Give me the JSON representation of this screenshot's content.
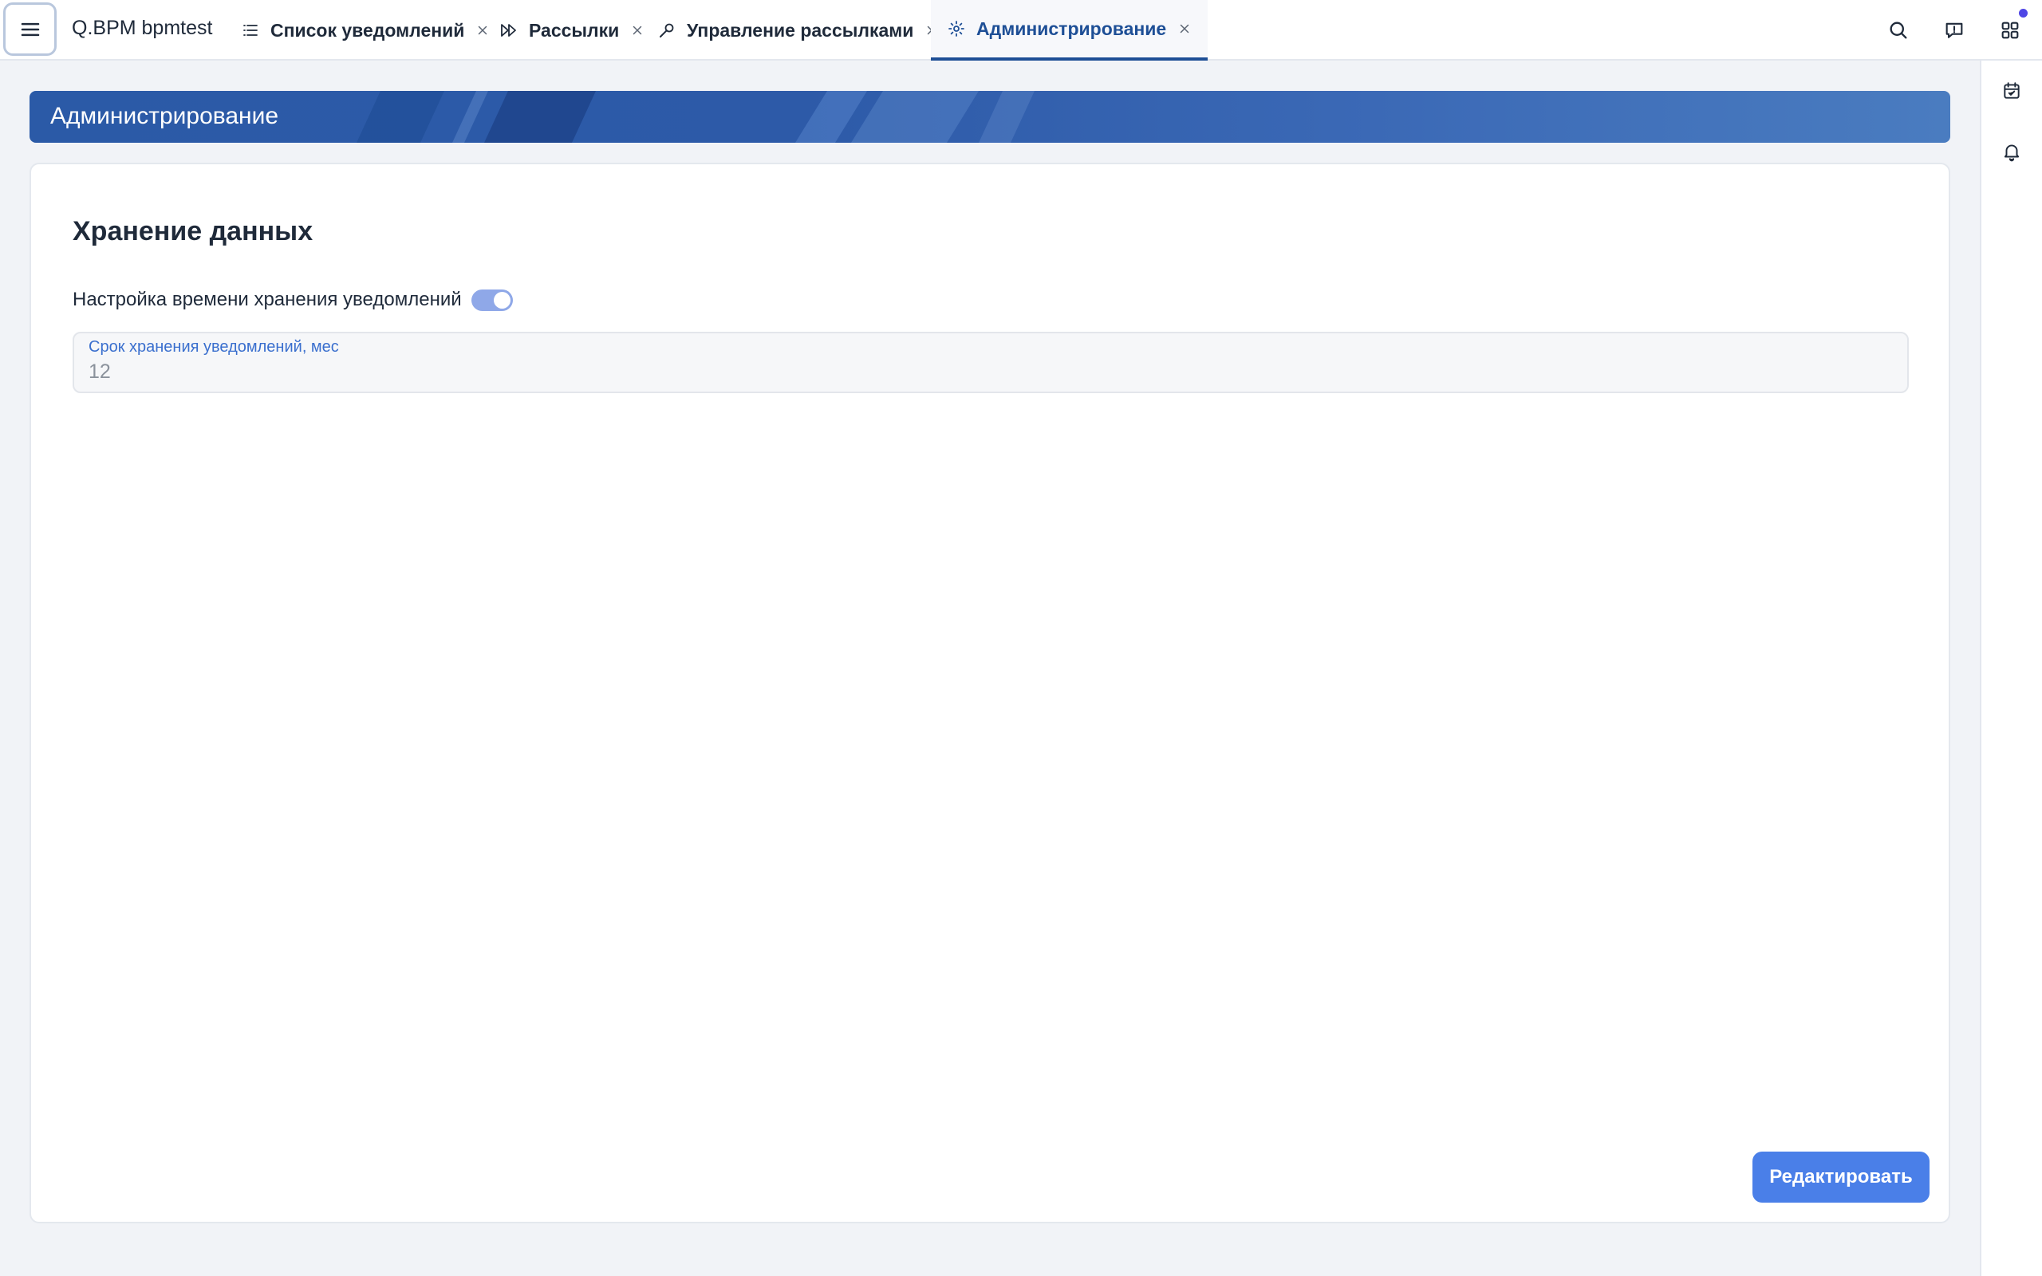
{
  "app": {
    "title": "Q.BPM bpmtest"
  },
  "tabs": [
    {
      "label": "Список уведомлений",
      "icon": "list-icon",
      "active": false
    },
    {
      "label": "Рассылки",
      "icon": "fast-forward-icon",
      "active": false
    },
    {
      "label": "Управление рассылками",
      "icon": "wrench-icon",
      "active": false
    },
    {
      "label": "Администрирование",
      "icon": "gear-icon",
      "active": true
    }
  ],
  "header_icons": [
    "search-icon",
    "feedback-icon",
    "apps-grid-icon"
  ],
  "rail_icons": [
    "calendar-icon",
    "bell-icon"
  ],
  "page": {
    "banner_title": "Администрирование",
    "section_title": "Хранение данных",
    "setting": {
      "label": "Настройка времени хранения уведомлений",
      "enabled": true
    },
    "field": {
      "label": "Срок хранения уведомлений, мес",
      "value": "12"
    },
    "edit_button": "Редактировать"
  },
  "colors": {
    "accent": "#4a7fe8",
    "active_tab": "#1e4f96",
    "banner": "#2d5aa8",
    "toggle_on": "#8fa8e8",
    "notification_dot": "#4f46e5"
  }
}
